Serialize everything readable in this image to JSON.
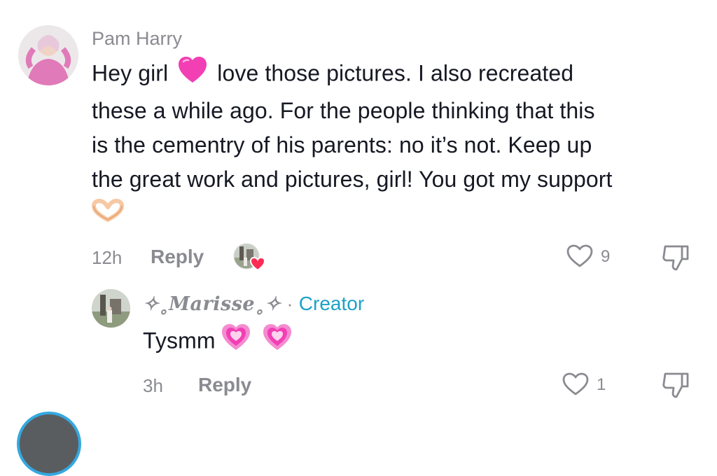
{
  "comment": {
    "username": "Pam Harry",
    "text_part1": "Hey girl",
    "text_line1_rest": "love those pictures. I also recreated",
    "text_line2": "these a while ago. For the people thinking that this",
    "text_line3": "is the cementry of his parents: no it’s not. Keep up",
    "text_line4": "the great work and pictures, girl! You got my support",
    "time": "12h",
    "reply_label": "Reply",
    "like_count": "9",
    "heart_emoji_icon": "pink-heart-emoji",
    "heart_hands_emoji_icon": "heart-hands-emoji",
    "creator_liked_icon": "creator-liked-avatar-icon"
  },
  "reply": {
    "username": "✧₀𝓜𝓪𝓻𝓲𝓼𝓼𝓮₀✧",
    "username_plain": "✧˳𝑴𝒂𝒓𝒊𝒔𝒔𝒆˳✧",
    "separator": "·",
    "badge": "Creator",
    "text": "Tysmm",
    "time": "3h",
    "reply_label": "Reply",
    "like_count": "1",
    "emoji_icon": "growing-heart-emoji"
  },
  "colors": {
    "text": "#161823",
    "muted": "#8a8b91",
    "creator": "#1da1c6",
    "heart_pink": "#f23fb4"
  }
}
